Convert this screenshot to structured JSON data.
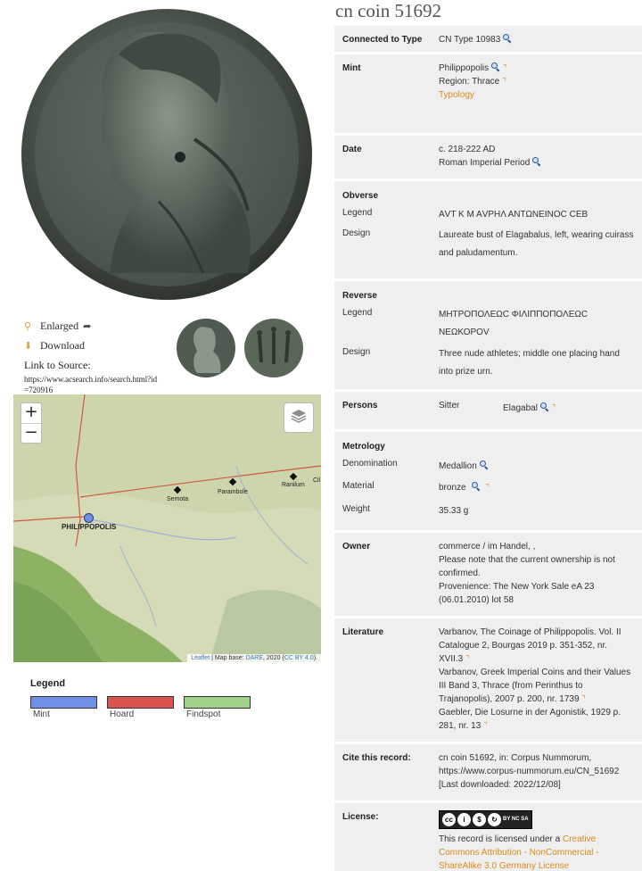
{
  "title": "cn coin 51692",
  "left": {
    "enlarged": "Enlarged",
    "download": "Download",
    "source_label": "Link to Source:",
    "source_url": "https://www.acsearch.info/search.html?id=720916"
  },
  "map": {
    "zoom_in": "+",
    "zoom_out": "−",
    "places": {
      "philippopolis": "PHILIPPOPOLIS",
      "semota": "Semota",
      "parambole": "Parambole",
      "ranilum": "Ranilum",
      "cil": "Cil"
    },
    "attribution": {
      "leaflet": "Leaflet",
      "map_base": " | Map base: ",
      "dare": "DARE",
      "year": ", 2020 (",
      "license": "CC BY 4.0",
      "end": ")."
    }
  },
  "legend": {
    "title": "Legend",
    "items": [
      {
        "label": "Mint",
        "color": "#6f8fe6"
      },
      {
        "label": "Hoard",
        "color": "#d9534f"
      },
      {
        "label": "Findspot",
        "color": "#9ed08a"
      }
    ]
  },
  "details": {
    "connected_label": "Connected to Type",
    "connected_value": "CN Type 10983",
    "mint_label": "Mint",
    "mint_value": "Philippopolis",
    "region_value": "Region: Thrace",
    "typology": "Typology",
    "date_label": "Date",
    "date_value": "c. 218-222 AD",
    "period_value": "Roman Imperial Period",
    "obverse_title": "Obverse",
    "obv_legend_label": "Legend",
    "obv_legend_value": "ΑVΤ Κ Μ ΑVΡΗΛ ΑΝΤΩΝΕΙΝΟϹ ϹΕΒ",
    "obv_design_label": "Design",
    "obv_design_value": "Laureate bust of Elagabalus, left, wearing cuirass and paludamentum.",
    "reverse_title": "Reverse",
    "rev_legend_label": "Legend",
    "rev_legend_value": "ΜΗΤΡΟΠΟΛΕΩϹ ΦΙΛΙΠΠΟΠΟΛΕΩϹ ΝΕΩΚΟΡΟV",
    "rev_design_label": "Design",
    "rev_design_value": "Three nude athletes; middle one placing hand into prize urn.",
    "persons_label": "Persons",
    "persons_role": "Sitter",
    "persons_name": "Elagabal",
    "metrology_title": "Metrology",
    "denomination_label": "Denomination",
    "denomination_value": "Medallion",
    "material_label": "Material",
    "material_value": "bronze",
    "weight_label": "Weight",
    "weight_value": "35.33 g",
    "owner_label": "Owner",
    "owner_line1": "commerce / im Handel, ,",
    "owner_line2": "Please note that the current ownership is not confirmed.",
    "owner_line3": "Provenience: The New York Sale eA 23 (06.01.2010) lot 58",
    "literature_label": "Literature",
    "lit1": "Varbanov, The Coinage of Philippopolis. Vol. II Catalogue 2, Bourgas 2019 p. 351-352, nr. XVII.3",
    "lit2": "Varbanov, Greek Imperial Coins and their Values III Band 3, Thrace (from Perinthus to Trajanopolis), 2007 p. 200, nr. 1739",
    "lit3": "Gaebler, Die Losurne in der Agonistik, 1929 p. 281, nr. 13",
    "cite_label": "Cite this record:",
    "cite_line1": "cn coin 51692, in: Corpus Nummorum,",
    "cite_line2": "https://www.corpus-nummorum.eu/CN_51692",
    "cite_line3": "[Last downloaded: 2022/12/08]",
    "license_label": "License:",
    "license_text": "This record is licensed under a ",
    "license_link": "Creative Commons Attribution - NonCommercial - ShareAlike 3.0 Germany License",
    "cc_badge": "BY NC SA"
  }
}
